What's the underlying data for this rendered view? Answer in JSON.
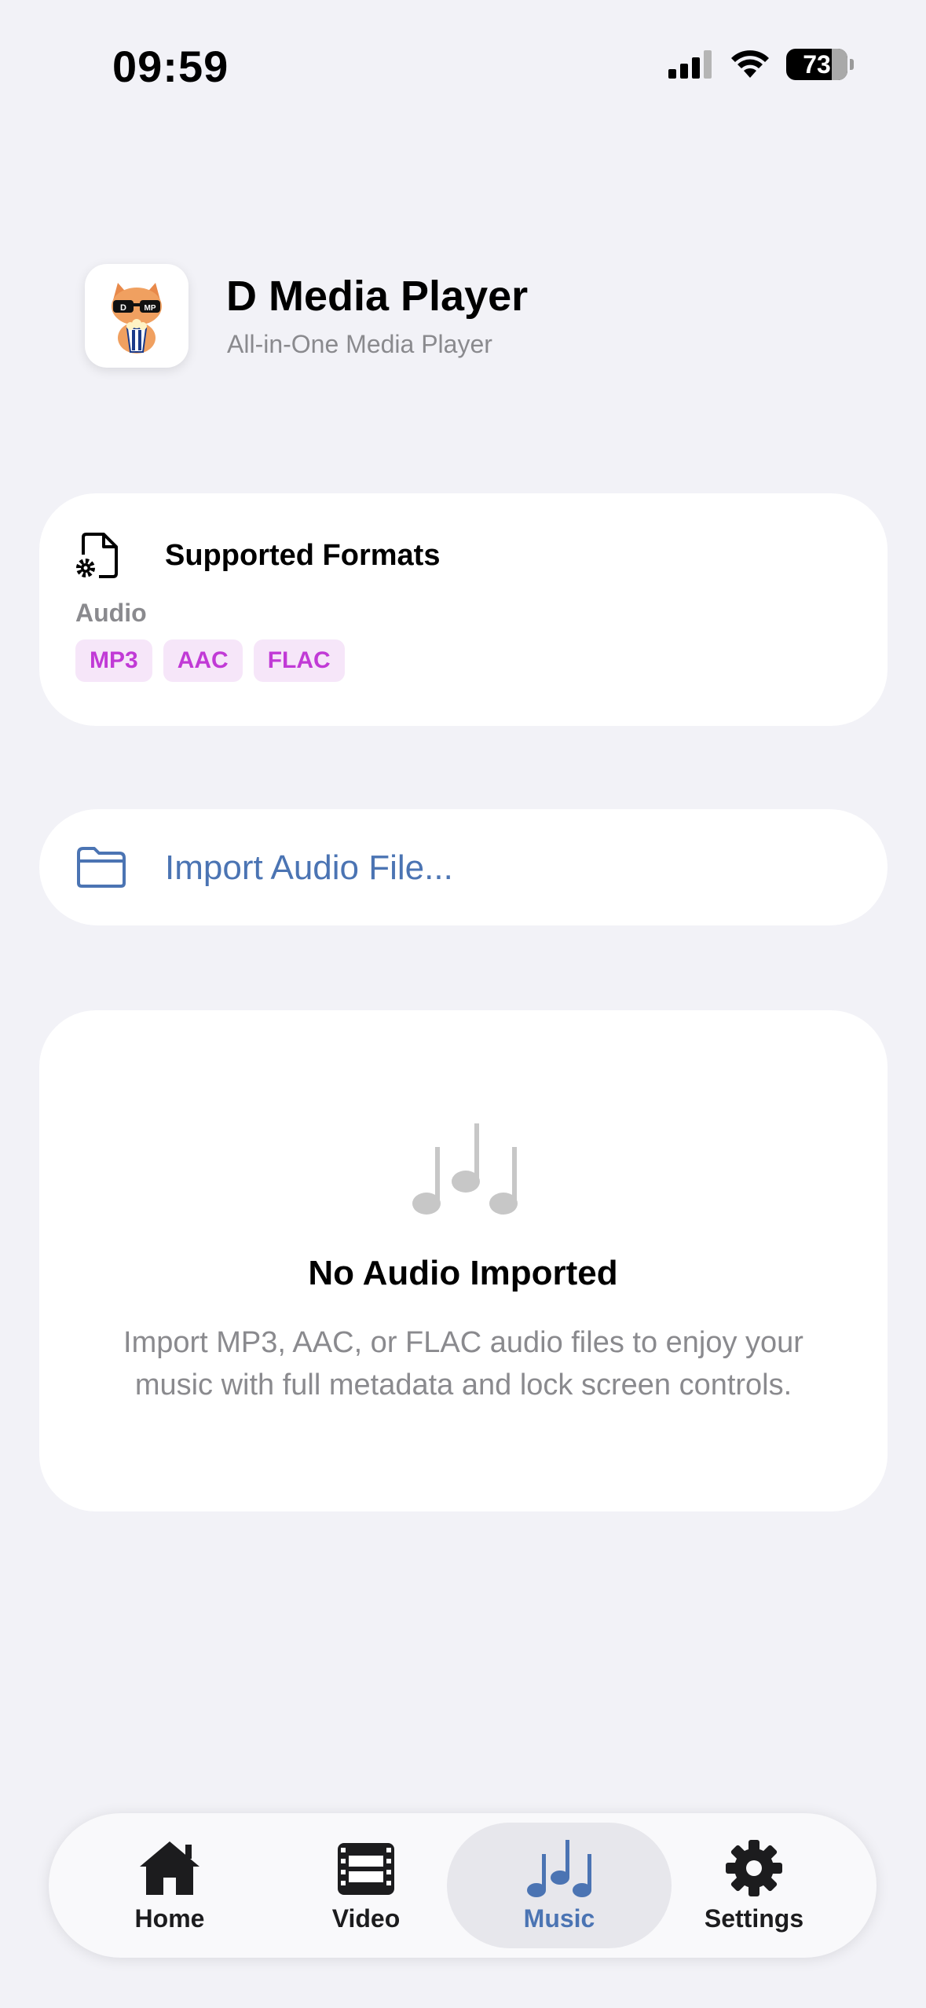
{
  "status_bar": {
    "time": "09:59",
    "battery": "73"
  },
  "header": {
    "title": "D Media Player",
    "subtitle": "All-in-One Media Player"
  },
  "formats_card": {
    "title": "Supported Formats",
    "category": "Audio",
    "formats": [
      "MP3",
      "AAC",
      "FLAC"
    ]
  },
  "import": {
    "label": "Import Audio File..."
  },
  "empty_state": {
    "title": "No Audio Imported",
    "description": "Import MP3, AAC, or FLAC audio files to enjoy your music with full metadata and lock screen controls."
  },
  "tabs": [
    {
      "label": "Home",
      "icon": "house-icon"
    },
    {
      "label": "Video",
      "icon": "film-icon"
    },
    {
      "label": "Music",
      "icon": "music-notes-icon",
      "active": true
    },
    {
      "label": "Settings",
      "icon": "gear-icon"
    }
  ],
  "colors": {
    "accent": "#4b74b3",
    "chip_text": "#c13ad6",
    "chip_bg": "#f6e6f9",
    "background": "#f2f2f7"
  }
}
